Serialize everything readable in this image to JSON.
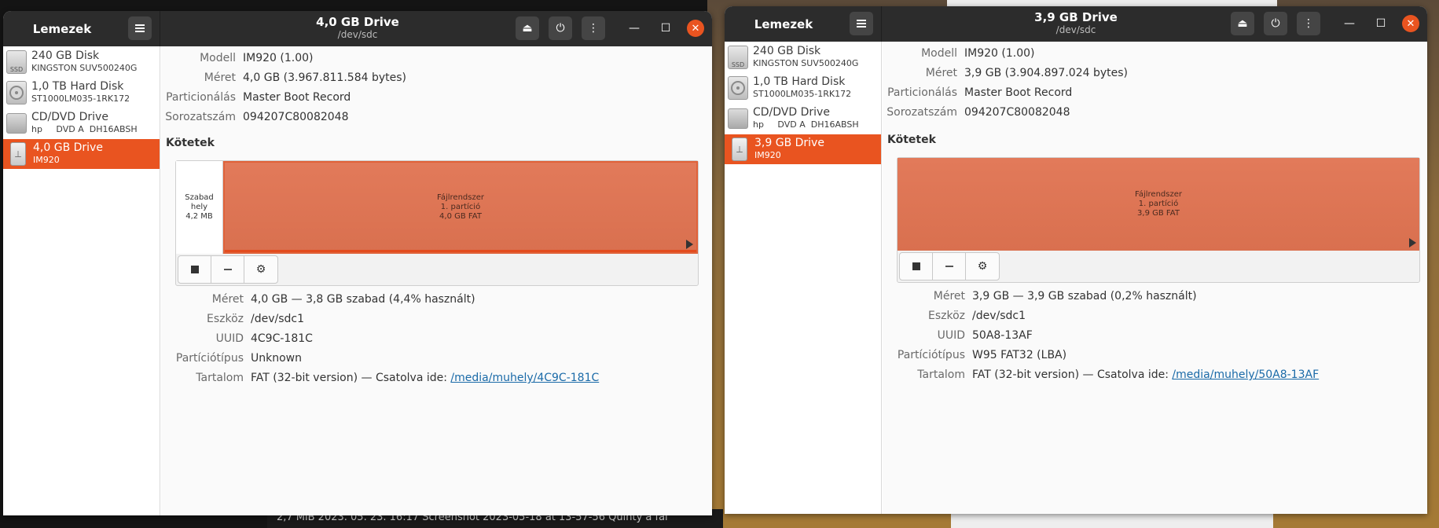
{
  "background": {
    "taskbar_text": "2,7 MiB  2023. 05. 23. 16:17  Screenshot 2023-05-18 at 13-57-56 Quinty a fal"
  },
  "windows": [
    {
      "app_title": "Lemezek",
      "title": "4,0 GB Drive",
      "subtitle": "/dev/sdc",
      "sidebar": [
        {
          "name": "240 GB Disk",
          "sub": "KINGSTON SUV500240G",
          "icon": "ssd-icon",
          "icon_text": "SSD",
          "active": false
        },
        {
          "name": "1,0 TB Hard Disk",
          "sub": "ST1000LM035-1RK172",
          "icon": "hard-disk-icon",
          "active": false
        },
        {
          "name": "CD/DVD Drive",
          "sub": "hp     DVD A  DH16ABSH",
          "icon": "optical-drive-icon",
          "active": false
        },
        {
          "name": "4,0 GB Drive",
          "sub": "IM920",
          "icon": "usb-drive-icon",
          "active": true
        }
      ],
      "drive_info": [
        {
          "key": "Modell",
          "value": "IM920 (1.00)"
        },
        {
          "key": "Méret",
          "value": "4,0 GB (3.967.811.584 bytes)"
        },
        {
          "key": "Particionálás",
          "value": "Master Boot Record"
        },
        {
          "key": "Sorozatszám",
          "value": "094207C80082048"
        }
      ],
      "volumes_heading": "Kötetek",
      "free_segment": {
        "line1": "Szabad hely",
        "line2": "4,2 MB"
      },
      "partition": {
        "line1": "Fájlrendszer",
        "line2": "1. partíció",
        "line3": "4,0 GB FAT"
      },
      "volume_info": [
        {
          "key": "Méret",
          "value": "4,0 GB — 3,8 GB szabad (4,4% használt)"
        },
        {
          "key": "Eszköz",
          "value": "/dev/sdc1"
        },
        {
          "key": "UUID",
          "value": "4C9C-181C"
        },
        {
          "key": "Partíciótípus",
          "value": "Unknown"
        },
        {
          "key": "Tartalom",
          "value": "FAT (32-bit version) — Csatolva ide: ",
          "link": "/media/muhely/4C9C-181C"
        }
      ]
    },
    {
      "app_title": "Lemezek",
      "title": "3,9 GB Drive",
      "subtitle": "/dev/sdc",
      "sidebar": [
        {
          "name": "240 GB Disk",
          "sub": "KINGSTON SUV500240G",
          "icon": "ssd-icon",
          "icon_text": "SSD",
          "active": false
        },
        {
          "name": "1,0 TB Hard Disk",
          "sub": "ST1000LM035-1RK172",
          "icon": "hard-disk-icon",
          "active": false
        },
        {
          "name": "CD/DVD Drive",
          "sub": "hp     DVD A  DH16ABSH",
          "icon": "optical-drive-icon",
          "active": false
        },
        {
          "name": "3,9 GB Drive",
          "sub": "IM920",
          "icon": "usb-drive-icon",
          "active": true
        }
      ],
      "drive_info": [
        {
          "key": "Modell",
          "value": "IM920 (1.00)"
        },
        {
          "key": "Méret",
          "value": "3,9 GB (3.904.897.024 bytes)"
        },
        {
          "key": "Particionálás",
          "value": "Master Boot Record"
        },
        {
          "key": "Sorozatszám",
          "value": "094207C80082048"
        }
      ],
      "volumes_heading": "Kötetek",
      "partition": {
        "line1": "Fájlrendszer",
        "line2": "1. partíció",
        "line3": "3,9 GB FAT"
      },
      "volume_info": [
        {
          "key": "Méret",
          "value": "3,9 GB — 3,9 GB szabad (0,2% használt)"
        },
        {
          "key": "Eszköz",
          "value": "/dev/sdc1"
        },
        {
          "key": "UUID",
          "value": "50A8-13AF"
        },
        {
          "key": "Partíciótípus",
          "value": "W95 FAT32 (LBA)"
        },
        {
          "key": "Tartalom",
          "value": "FAT (32-bit version) — Csatolva ide: ",
          "link": "/media/muhely/50A8-13AF"
        }
      ]
    }
  ]
}
